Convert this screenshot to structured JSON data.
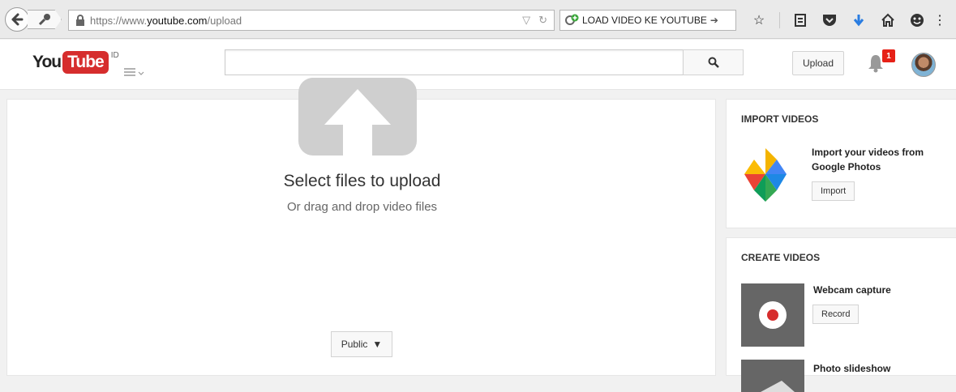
{
  "browser": {
    "url_prefix": "https://www.",
    "url_host": "youtube.com",
    "url_path": "/upload",
    "search_text": "LOAD VIDEO KE YOUTUBE"
  },
  "header": {
    "logo_you": "You",
    "logo_tube": "Tube",
    "region": "ID",
    "upload_label": "Upload",
    "notification_count": "1",
    "search_placeholder": ""
  },
  "upload": {
    "title": "Select files to upload",
    "subtitle": "Or drag and drop video files",
    "privacy_label": "Public"
  },
  "import_card": {
    "title": "IMPORT VIDEOS",
    "text_line1": "Import your videos from",
    "text_line2": "Google Photos",
    "button_label": "Import"
  },
  "create_card": {
    "title": "CREATE VIDEOS",
    "webcam_label": "Webcam capture",
    "record_label": "Record",
    "slideshow_label": "Photo slideshow"
  },
  "colors": {
    "brand_red": "#d62d2d",
    "badge_red": "#e62117",
    "upload_icon_gray": "#cfcfcf"
  }
}
